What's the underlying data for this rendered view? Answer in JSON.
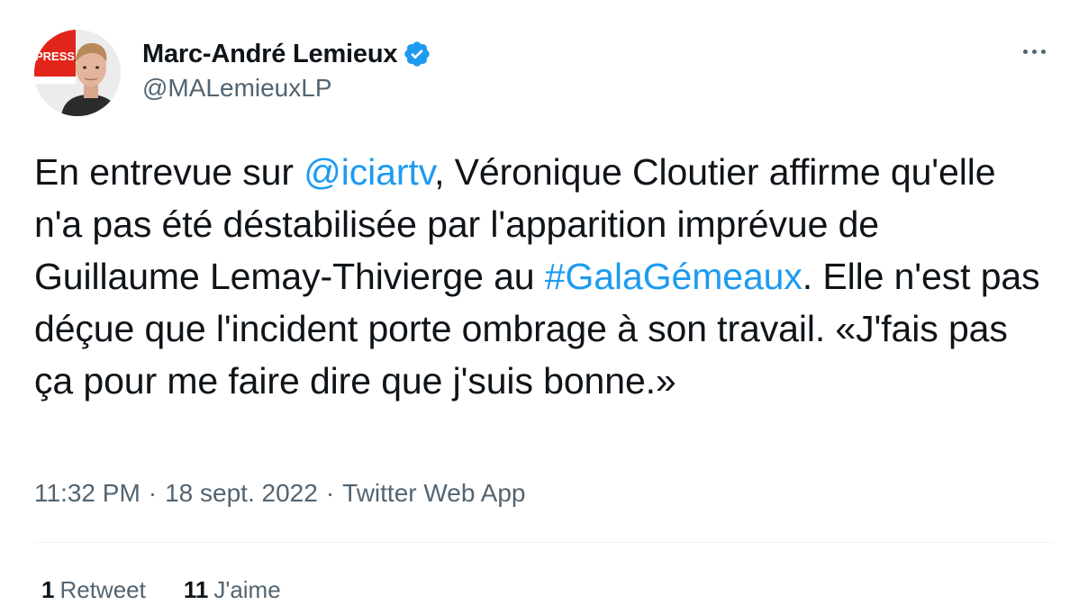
{
  "author": {
    "display_name": "Marc-André Lemieux",
    "handle": "@MALemieuxLP",
    "verified": true,
    "avatar_badge_text": "PRESSE"
  },
  "tweet": {
    "segments": [
      {
        "text": "En entrevue sur ",
        "type": "text"
      },
      {
        "text": "@iciartv",
        "type": "mention"
      },
      {
        "text": ", Véronique Cloutier affirme qu'elle n'a pas été déstabilisée par l'apparition imprévue de Guillaume Lemay-Thivierge au ",
        "type": "text"
      },
      {
        "text": "#GalaGémeaux",
        "type": "hashtag"
      },
      {
        "text": ". Elle n'est pas déçue que l'incident porte ombrage à son travail. «J'fais pas ça pour me faire dire que j'suis bonne.»",
        "type": "text"
      }
    ]
  },
  "meta": {
    "time": "11:32 PM",
    "separator": "·",
    "date": "18 sept. 2022",
    "source": "Twitter Web App"
  },
  "stats": {
    "retweets_count": "1",
    "retweets_label": "Retweet",
    "likes_count": "11",
    "likes_label": "J'aime"
  },
  "colors": {
    "link": "#1d9bf0",
    "verified": "#1d9bf0",
    "secondary_text": "#536471",
    "primary_text": "#0f1419",
    "divider": "#eff3f4"
  },
  "icons": {
    "verified": "verified-badge-icon",
    "more": "more-horizontal-icon"
  }
}
